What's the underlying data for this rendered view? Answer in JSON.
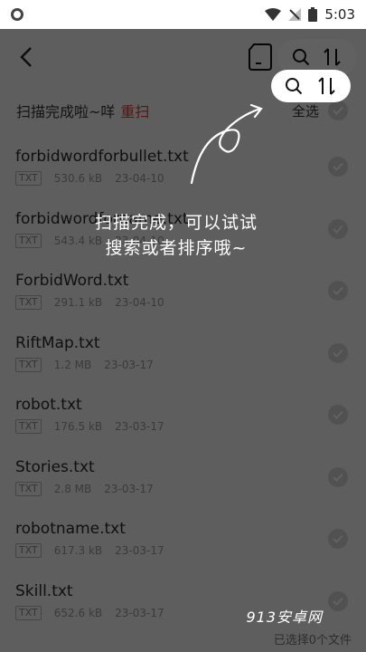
{
  "status_bar": {
    "time": "5:03"
  },
  "header": {
    "back_label": "<"
  },
  "scan": {
    "status": "扫描完成啦~咩",
    "rescan": "重扫",
    "select_all": "全选"
  },
  "files": [
    {
      "name": "forbidwordforbullet.txt",
      "type": "TXT",
      "size": "530.6 kB",
      "date": "23-04-10"
    },
    {
      "name": "forbidwordforname.txt",
      "type": "TXT",
      "size": "543.4 kB",
      "date": "23-04-10"
    },
    {
      "name": "ForbidWord.txt",
      "type": "TXT",
      "size": "291.1 kB",
      "date": "23-04-10"
    },
    {
      "name": "RiftMap.txt",
      "type": "TXT",
      "size": "1.2 MB",
      "date": "23-03-17"
    },
    {
      "name": "robot.txt",
      "type": "TXT",
      "size": "176.5 kB",
      "date": "23-03-17"
    },
    {
      "name": "Stories.txt",
      "type": "TXT",
      "size": "2.8 MB",
      "date": "23-03-17"
    },
    {
      "name": "robotname.txt",
      "type": "TXT",
      "size": "617.3 kB",
      "date": "23-03-17"
    },
    {
      "name": "Skill.txt",
      "type": "TXT",
      "size": "652.6 kB",
      "date": "23-03-17"
    }
  ],
  "footer": {
    "selected": "已选择0个文件"
  },
  "hint": {
    "line1": "扫描完成，可以试试",
    "line2": "搜索或者排序哦~"
  },
  "watermark": "913安卓网",
  "colors": {
    "accent": "#e23a3a",
    "overlay": "rgba(0,0,0,0.62)"
  }
}
